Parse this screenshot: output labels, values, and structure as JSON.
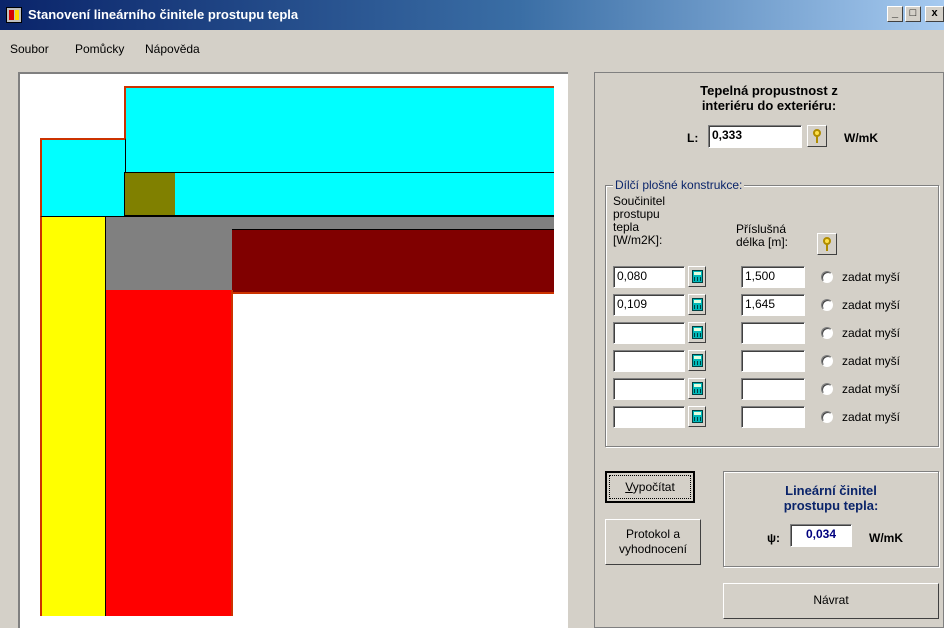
{
  "window": {
    "title": "Stanovení lineárního činitele prostupu tepla",
    "minimize_glyph": "_",
    "maximize_glyph": "□",
    "close_glyph": "x"
  },
  "menu": {
    "items": [
      {
        "label": "Soubor"
      },
      {
        "label": "Pomůcky"
      },
      {
        "label": "Nápověda"
      }
    ]
  },
  "drawing": {
    "colors": {
      "cyan": "#00ffff",
      "olive": "#808000",
      "yellow": "#ffff00",
      "gray": "#808080",
      "dark_red": "#800000",
      "red": "#ff0000",
      "outline": "#cc3300"
    }
  },
  "thermal": {
    "heading_line1": "Tepelná propustnost z",
    "heading_line2": "interiéru do exteriéru:",
    "label": "L:",
    "value": "0,333",
    "unit": "W/mK"
  },
  "partial": {
    "group_title": "Dílčí plošné konstrukce:",
    "col1_line1": "Součinitel",
    "col1_line2": "prostupu",
    "col1_line3": "tepla",
    "col1_line4": "[W/m2K]:",
    "col2_line1": "Příslušná",
    "col2_line2": "délka [m]:",
    "radio_label": "zadat myší",
    "rows": [
      {
        "u": "0,080",
        "length": "1,500"
      },
      {
        "u": "0,109",
        "length": "1,645"
      },
      {
        "u": "",
        "length": ""
      },
      {
        "u": "",
        "length": ""
      },
      {
        "u": "",
        "length": ""
      },
      {
        "u": "",
        "length": ""
      }
    ]
  },
  "buttons": {
    "calculate_hotkey": "V",
    "calculate_rest": "ypočítat",
    "protocol_line1": "Protokol a",
    "protocol_line2": "vyhodnocení",
    "back": "Návrat"
  },
  "result": {
    "heading_line1": "Lineární činitel",
    "heading_line2": "prostupu tepla:",
    "symbol": "ψ:",
    "value": "0,034",
    "unit": "W/mK",
    "color": "#00007f"
  }
}
